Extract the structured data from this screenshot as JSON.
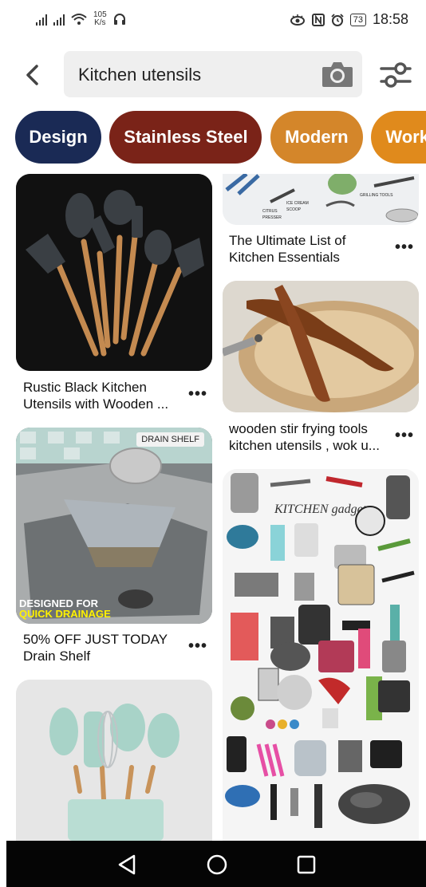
{
  "status_bar": {
    "speed_value": "105",
    "speed_unit": "K/s",
    "battery": "73",
    "time": "18:58"
  },
  "search": {
    "query": "Kitchen utensils",
    "back_icon": "chevron-left-icon",
    "camera_icon": "camera-icon",
    "filter_icon": "sliders-icon"
  },
  "chips": [
    {
      "label": "Design",
      "color": "#1a2a55"
    },
    {
      "label": "Stainless Steel",
      "color": "#7a2318"
    },
    {
      "label": "Modern",
      "color": "#d4862a"
    },
    {
      "label": "Workspace",
      "color": "#e08a1c"
    }
  ],
  "pins": {
    "black_utensils": {
      "title": "Rustic Black Kitchen Utensils with Wooden ..."
    },
    "drain_shelf": {
      "badge": "DRAIN SHELF",
      "promo_line1": "DESIGNED FOR",
      "promo_line2": "QUICK DRAINAGE",
      "title_line1": "50% OFF JUST TODAY",
      "title_line2": "Drain Shelf"
    },
    "essentials": {
      "title_line1": "The Ultimate List of",
      "title_line2": "Kitchen Essentials",
      "image_labels": [
        "CITRUS",
        "PRESSER",
        "ICE CREAM",
        "SCOOP",
        "GRILLING TOOLS"
      ]
    },
    "wok": {
      "title_line1": "wooden stir frying tools",
      "title_line2": "kitchen utensils , wok u..."
    },
    "gadgets": {
      "image_title": "KITCHEN gadgets"
    }
  },
  "more_label": "•••",
  "nav": {
    "back_icon": "triangle-back-icon",
    "home_icon": "circle-home-icon",
    "recents_icon": "square-recents-icon"
  }
}
